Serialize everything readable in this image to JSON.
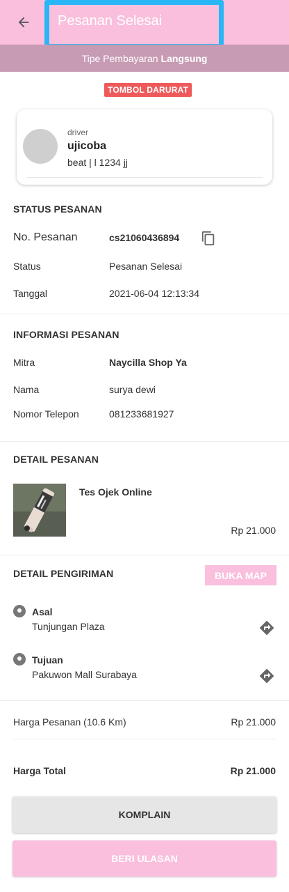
{
  "colors": {
    "appbar": "#f9bfdd",
    "paybar": "#c79bb4",
    "highlight_border": "#29b6f6",
    "emergency": "#ee5a5a",
    "button_grey": "#e6e6e6"
  },
  "header": {
    "back_icon": "arrow-left-icon",
    "title": "Pesanan Selesai"
  },
  "payment": {
    "prefix": "Tipe Pembayaran",
    "type": "Langsung"
  },
  "emergency_label": "TOMBOL DARURAT",
  "driver": {
    "role": "driver",
    "name": "ujicoba",
    "vehicle": "beat | l 1234 jj"
  },
  "status_section": {
    "title": "STATUS PESANAN",
    "order_no_label": "No. Pesanan",
    "order_no": "cs21060436894",
    "copy_icon": "copy-icon",
    "status_label": "Status",
    "status": "Pesanan Selesai",
    "date_label": "Tanggal",
    "date": "2021-06-04 12:13:34"
  },
  "info_section": {
    "title": "INFORMASI PESANAN",
    "partner_label": "Mitra",
    "partner": "Naycilla Shop Ya",
    "name_label": "Nama",
    "name": "surya dewi",
    "phone_label": "Nomor Telepon",
    "phone": "081233681927"
  },
  "detail_section": {
    "title": "DETAIL PESANAN",
    "item_name": "Tes Ojek Online",
    "item_price": "Rp 21.000"
  },
  "shipping_section": {
    "title": "DETAIL PENGIRIMAN",
    "map_button": "BUKA MAP",
    "origin_label": "Asal",
    "origin": "Tunjungan Plaza",
    "destination_label": "Tujuan",
    "destination": "Pakuwon Mall Surabaya",
    "pin_icon": "location-pin-icon",
    "direction_icon": "directions-icon"
  },
  "pricing": {
    "order_price_label": "Harga Pesanan (10.6 Km)",
    "order_price": "Rp 21.000",
    "total_label": "Harga Total",
    "total": "Rp 21.000"
  },
  "actions": {
    "complain": "KOMPLAIN",
    "review": "BERI ULASAN"
  }
}
